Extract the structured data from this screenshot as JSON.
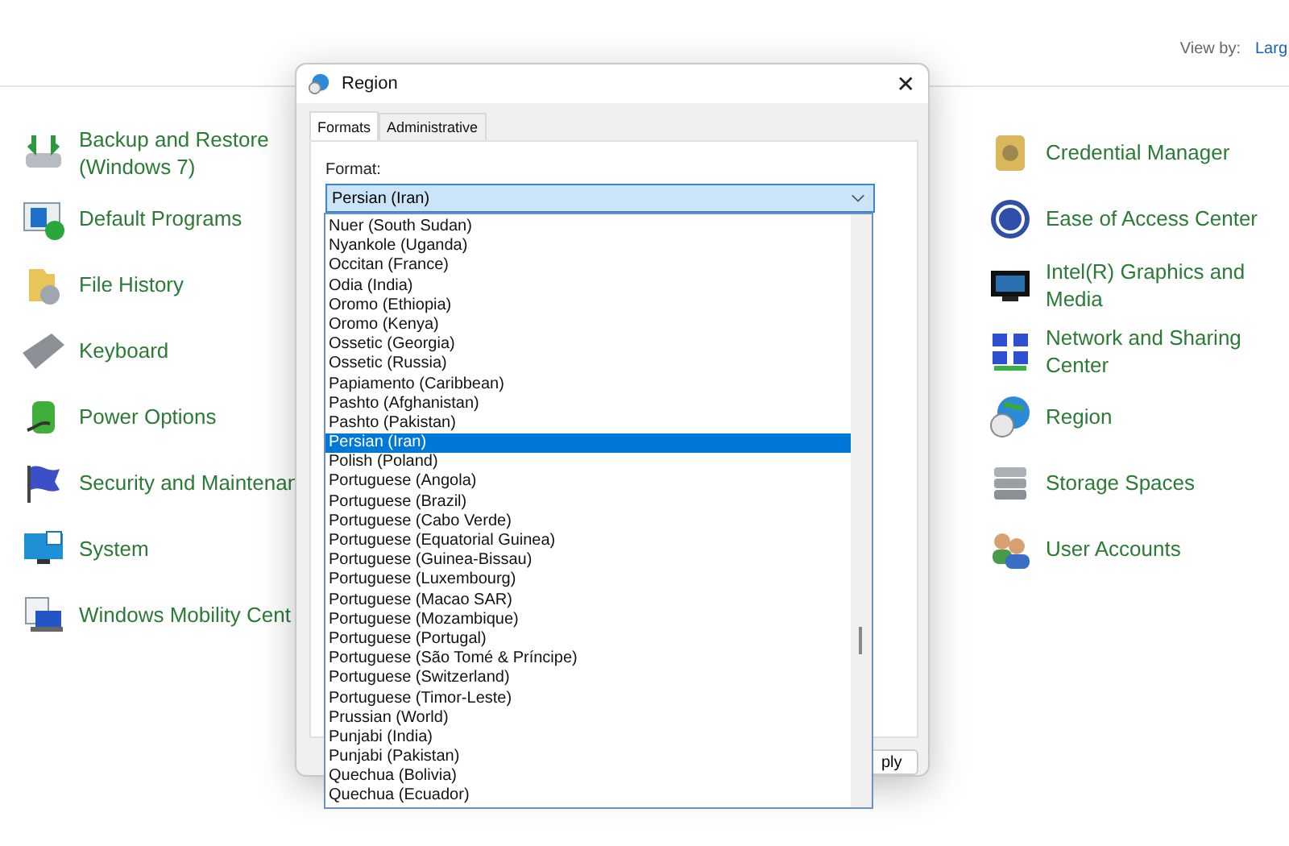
{
  "header": {
    "view_by_label": "View by:",
    "view_by_value": "Larg"
  },
  "left_items": [
    {
      "label": "Backup and Restore (Windows 7)"
    },
    {
      "label": "Default Programs"
    },
    {
      "label": "File History"
    },
    {
      "label": "Keyboard"
    },
    {
      "label": "Power Options"
    },
    {
      "label": "Security and Maintenan"
    },
    {
      "label": "System"
    },
    {
      "label": "Windows Mobility Cent"
    }
  ],
  "right_items": [
    {
      "label": "Credential Manager"
    },
    {
      "label": "Ease of Access Center"
    },
    {
      "label": "Intel(R) Graphics and Media"
    },
    {
      "label": "Network and Sharing Center"
    },
    {
      "label": "Region"
    },
    {
      "label": "Storage Spaces"
    },
    {
      "label": "User Accounts"
    }
  ],
  "dialog": {
    "title": "Region",
    "close": "✕",
    "tabs": [
      {
        "label": "Formats",
        "selected": true
      },
      {
        "label": "Administrative",
        "selected": false
      }
    ],
    "format_label": "Format:",
    "format_value": "Persian (Iran)",
    "apply_button": "ply",
    "dropdown_items": [
      {
        "label": "Nuer (South Sudan)",
        "selected": false
      },
      {
        "label": "Nyankole (Uganda)",
        "selected": false
      },
      {
        "label": "Occitan (France)",
        "selected": false
      },
      {
        "label": "Odia (India)",
        "selected": false
      },
      {
        "label": "Oromo (Ethiopia)",
        "selected": false
      },
      {
        "label": "Oromo (Kenya)",
        "selected": false
      },
      {
        "label": "Ossetic (Georgia)",
        "selected": false
      },
      {
        "label": "Ossetic (Russia)",
        "selected": false
      },
      {
        "label": "Papiamento (Caribbean)",
        "selected": false
      },
      {
        "label": "Pashto (Afghanistan)",
        "selected": false
      },
      {
        "label": "Pashto (Pakistan)",
        "selected": false
      },
      {
        "label": "Persian (Iran)",
        "selected": true
      },
      {
        "label": "Polish (Poland)",
        "selected": false
      },
      {
        "label": "Portuguese (Angola)",
        "selected": false
      },
      {
        "label": "Portuguese (Brazil)",
        "selected": false
      },
      {
        "label": "Portuguese (Cabo Verde)",
        "selected": false
      },
      {
        "label": "Portuguese (Equatorial Guinea)",
        "selected": false
      },
      {
        "label": "Portuguese (Guinea-Bissau)",
        "selected": false
      },
      {
        "label": "Portuguese (Luxembourg)",
        "selected": false
      },
      {
        "label": "Portuguese (Macao SAR)",
        "selected": false
      },
      {
        "label": "Portuguese (Mozambique)",
        "selected": false
      },
      {
        "label": "Portuguese (Portugal)",
        "selected": false
      },
      {
        "label": "Portuguese (São Tomé & Príncipe)",
        "selected": false
      },
      {
        "label": "Portuguese (Switzerland)",
        "selected": false
      },
      {
        "label": "Portuguese (Timor-Leste)",
        "selected": false
      },
      {
        "label": "Prussian (World)",
        "selected": false
      },
      {
        "label": "Punjabi (India)",
        "selected": false
      },
      {
        "label": "Punjabi (Pakistan)",
        "selected": false
      },
      {
        "label": "Quechua (Bolivia)",
        "selected": false
      },
      {
        "label": "Quechua (Ecuador)",
        "selected": false
      }
    ]
  }
}
